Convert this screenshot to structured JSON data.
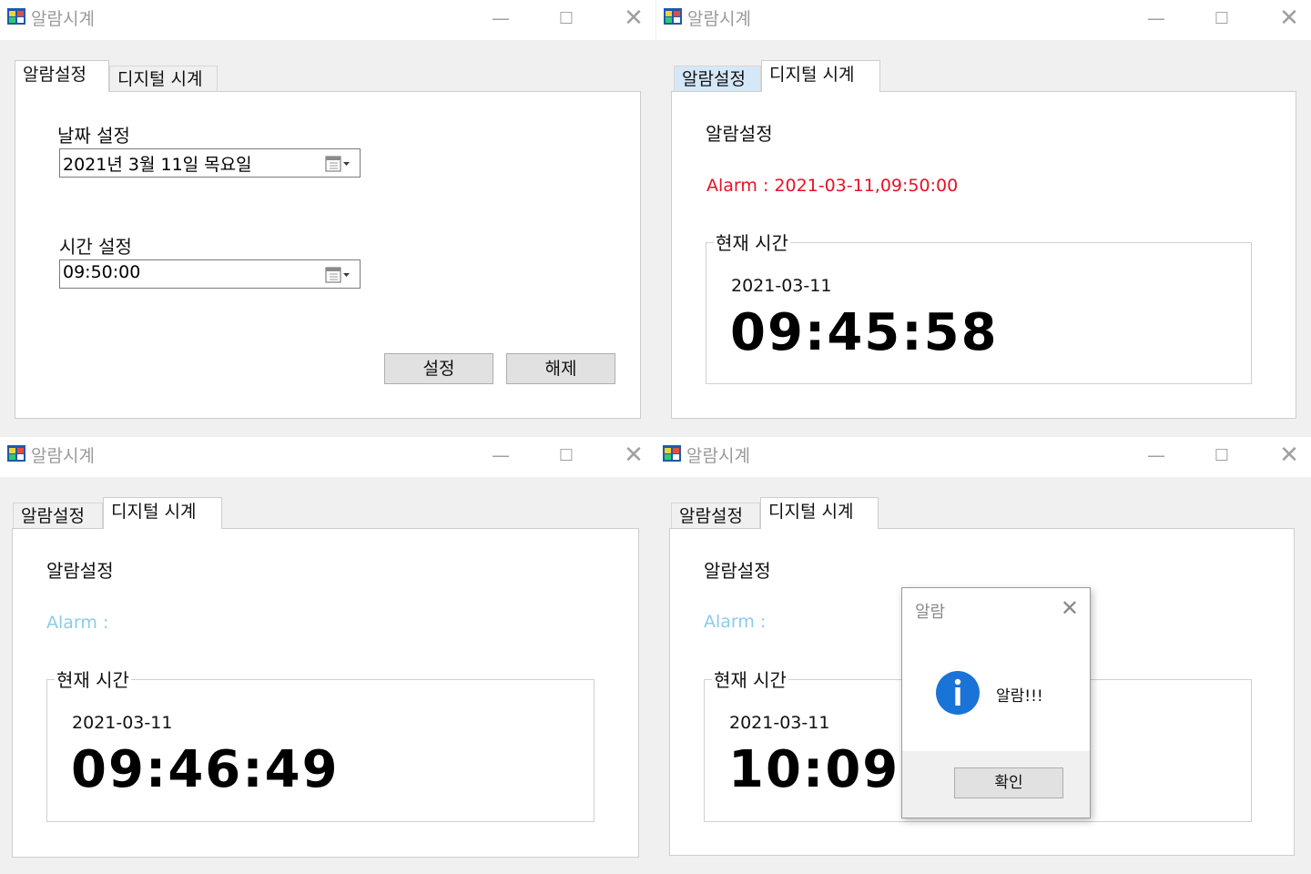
{
  "title": "알람시계",
  "controls": {
    "minimize": "—",
    "maximize": "☐",
    "close": "✕"
  },
  "tabs": {
    "alarm_setting": "알람설정",
    "digital_clock": "디지털 시계"
  },
  "colors": {
    "alarm_red": "#e81123",
    "alarm_blue": "#8ccbe8"
  },
  "windows": [
    {
      "active_tab": "alarm_setting",
      "date_label": "날짜 설정",
      "date_value": "2021년   3월 11일 목요일",
      "time_label": "시간 설정",
      "time_value": "09:50:00",
      "set_button": "설정",
      "clear_button": "해제"
    },
    {
      "active_tab": "digital_clock",
      "heading": "알람설정",
      "alarm_text": "Alarm : 2021-03-11,09:50:00",
      "group_title": "현재 시간",
      "date": "2021-03-11",
      "time": "09:45:58"
    },
    {
      "active_tab": "digital_clock",
      "heading": "알람설정",
      "alarm_text": "Alarm :",
      "group_title": "현재 시간",
      "date": "2021-03-11",
      "time": "09:46:49"
    },
    {
      "active_tab": "digital_clock",
      "heading": "알람설정",
      "alarm_text": "Alarm :",
      "group_title": "현재 시간",
      "date": "2021-03-11",
      "time": "10:09:"
    }
  ],
  "message_box": {
    "title": "알람",
    "close": "✕",
    "icon": "info-icon",
    "text": "알람!!!",
    "ok_button": "확인"
  }
}
